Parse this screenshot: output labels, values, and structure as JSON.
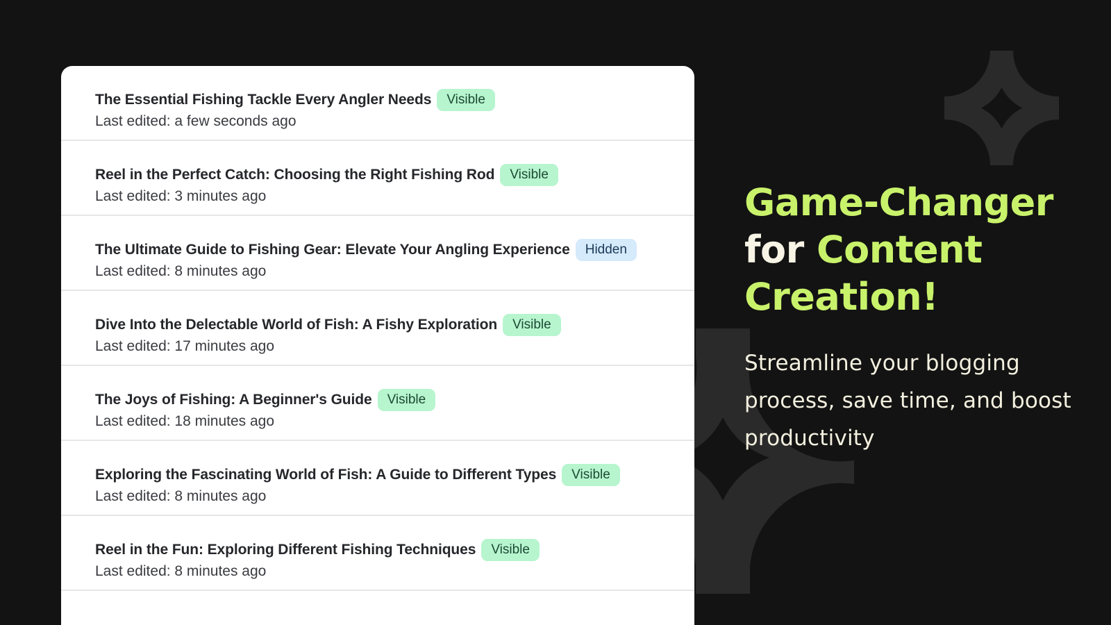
{
  "posts": [
    {
      "title": "The Essential Fishing Tackle Every Angler Needs",
      "status": "Visible",
      "status_type": "visible",
      "last_edited": "Last edited: a few seconds ago"
    },
    {
      "title": "Reel in the Perfect Catch: Choosing the Right Fishing Rod",
      "status": "Visible",
      "status_type": "visible",
      "last_edited": "Last edited: 3 minutes ago"
    },
    {
      "title": "The Ultimate Guide to Fishing Gear: Elevate Your Angling Experience",
      "status": "Hidden",
      "status_type": "hidden",
      "last_edited": "Last edited: 8 minutes ago"
    },
    {
      "title": "Dive Into the Delectable World of Fish: A Fishy Exploration",
      "status": "Visible",
      "status_type": "visible",
      "last_edited": "Last edited: 17 minutes ago"
    },
    {
      "title": "The Joys of Fishing: A Beginner's Guide",
      "status": "Visible",
      "status_type": "visible",
      "last_edited": "Last edited: 18 minutes ago"
    },
    {
      "title": "Exploring the Fascinating World of Fish: A Guide to Different Types",
      "status": "Visible",
      "status_type": "visible",
      "last_edited": "Last edited: 8 minutes ago"
    },
    {
      "title": "Reel in the Fun: Exploring Different Fishing Techniques",
      "status": "Visible",
      "status_type": "visible",
      "last_edited": "Last edited: 8 minutes ago"
    }
  ],
  "hero": {
    "headline_part1": "Game-Changer",
    "headline_part2": "for",
    "headline_part3": "Content Creation!",
    "subheadline": "Streamline your blogging process, save time, and boost productivity"
  },
  "colors": {
    "background": "#131313",
    "accent": "#c9f26b",
    "visible_badge": "#b7f5cf",
    "hidden_badge": "#d5eafb",
    "decoration": "#2a2a2a"
  },
  "icons": {
    "decoration_shape": "four-point-star-outline"
  }
}
